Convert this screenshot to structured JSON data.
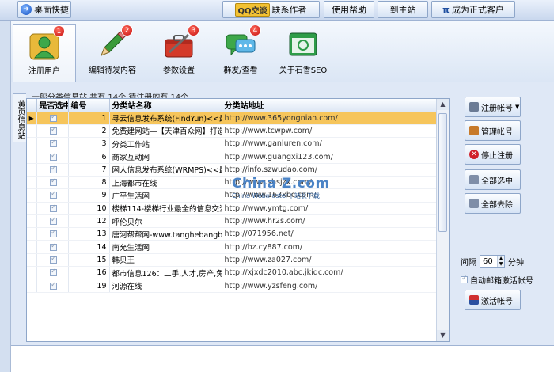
{
  "toolbar": {
    "desktop_shortcut": "桌面快捷",
    "qq_tag": "QQ交谈",
    "contact_author": "联系作者",
    "help": "使用帮助",
    "main_site": "到主站",
    "pi_symbol": "π",
    "become_customer": "成为正式客户"
  },
  "tools": [
    {
      "label": "注册用户",
      "badge": "1"
    },
    {
      "label": "编辑待发内容",
      "badge": "2"
    },
    {
      "label": "参数设置",
      "badge": "3"
    },
    {
      "label": "群发/查看",
      "badge": "4"
    },
    {
      "label": "关于石香SEO",
      "badge": ""
    }
  ],
  "side_tab": "黄页信息站",
  "summary": "一般分类信息站 共有 14个 待注册的有 14个",
  "grid": {
    "headers": [
      "是否选中",
      "编号",
      "分类站名称",
      "分类站地址"
    ],
    "rows": [
      {
        "num": "1",
        "name": "寻云信息发布系统(FindYun)<<最",
        "url": "http://www.365yongnian.com/"
      },
      {
        "num": "2",
        "name": "免费建网站—【天津百众网】打造",
        "url": "http://www.tcwpw.com/"
      },
      {
        "num": "3",
        "name": "分类工作站",
        "url": "http://www.ganluren.com/"
      },
      {
        "num": "6",
        "name": "商家互动网",
        "url": "http://www.guangxi123.com/"
      },
      {
        "num": "7",
        "name": "网人信息发布系统(WRMPS)<<最",
        "url": "http://info.szwudao.com/"
      },
      {
        "num": "8",
        "name": "上海都市在线",
        "url": "http://www.shsjzx.com/"
      },
      {
        "num": "9",
        "name": "广平生活网",
        "url": "http://www.163xbc.com/"
      },
      {
        "num": "10",
        "name": "楼梯114-楼梯行业最全的信息交流",
        "url": "http://www.ymtg.com/"
      },
      {
        "num": "12",
        "name": "呼伦贝尔",
        "url": "http://www.hr2s.com/"
      },
      {
        "num": "13",
        "name": "唐河帮帮网-www.tanghebangbang",
        "url": "http://071956.net/"
      },
      {
        "num": "14",
        "name": "南允生活网",
        "url": "http://bz.cy887.com/"
      },
      {
        "num": "15",
        "name": "韩贝王",
        "url": "http://www.za027.com/"
      },
      {
        "num": "16",
        "name": "都市信息126：二手,人才,房产,免费",
        "url": "http://xjxdc2010.abc.jkidc.com/"
      },
      {
        "num": "19",
        "name": "河源在线",
        "url": "http://www.yzsfeng.com/"
      }
    ],
    "selected_index": 0
  },
  "watermark": {
    "title": "China Z.com",
    "subtitle": "China Webmaster | 站长下载"
  },
  "right": {
    "register_account": "注册帐号",
    "manage_account": "管理帐号",
    "stop_register": "停止注册",
    "select_all": "全部选中",
    "remove_all": "全部去除",
    "interval_label": "间隔",
    "interval_value": "60",
    "interval_unit": "分钟",
    "auto_mail": "自动邮箱激活帐号",
    "activate_account": "激活帐号"
  },
  "colors": {
    "selected_row": "#f6c55b",
    "badge": "#d81e1e",
    "frame": "#dfe8f6"
  }
}
